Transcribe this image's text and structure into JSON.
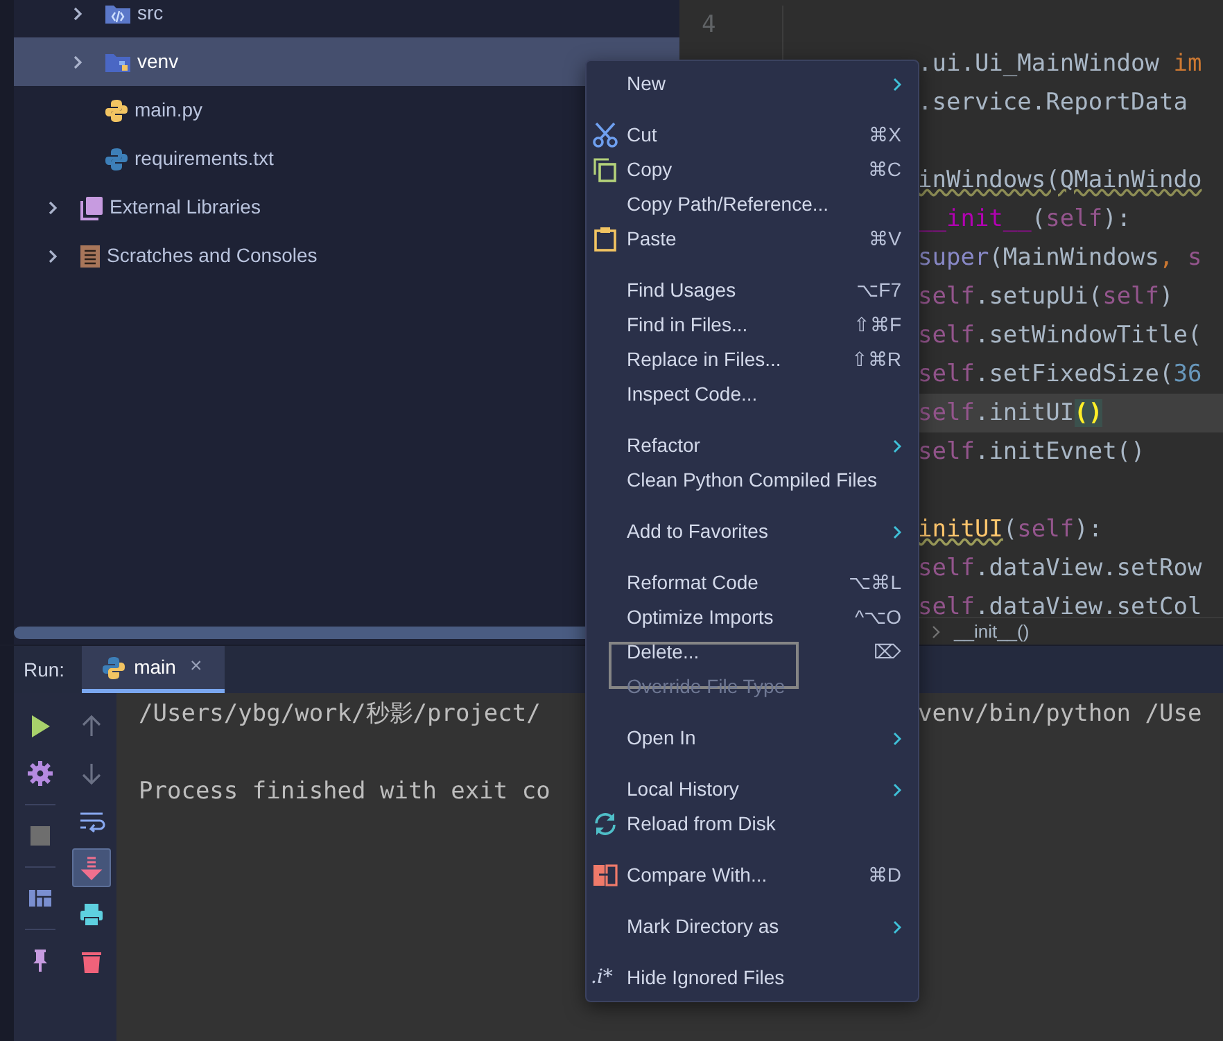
{
  "project_tree": {
    "root_children": [
      {
        "label": "src",
        "kind": "folder",
        "expanded": false,
        "selected": false
      },
      {
        "label": "venv",
        "kind": "folder",
        "expanded": false,
        "selected": true
      },
      {
        "label": "main.py",
        "kind": "file",
        "selected": false
      },
      {
        "label": "requirements.txt",
        "kind": "file",
        "selected": false
      }
    ],
    "items": [
      {
        "label": "External Libraries",
        "kind": "folder",
        "expanded": false,
        "selected": false
      },
      {
        "label": "Scratches and Consoles",
        "kind": "folder",
        "expanded": false,
        "selected": false
      }
    ]
  },
  "editor": {
    "line_number": "4",
    "lines": [
      {
        "kind": "code",
        "current": false,
        "segments": [
          {
            "kind": "plain",
            "text": ".ui.Ui_MainWindow "
          },
          {
            "kind": "keyword",
            "text": "im"
          }
        ]
      },
      {
        "kind": "code",
        "current": false,
        "segments": [
          {
            "kind": "plain",
            "text": ".service.ReportData"
          }
        ]
      },
      {
        "kind": "blank"
      },
      {
        "kind": "code",
        "current": false,
        "segments": [
          {
            "kind": "warn",
            "text": "inWindows(QMainWindo"
          }
        ]
      },
      {
        "kind": "code",
        "current": false,
        "segments": [
          {
            "kind": "magic",
            "text": "__init__"
          },
          {
            "kind": "plain",
            "text": "("
          },
          {
            "kind": "self",
            "text": "self"
          },
          {
            "kind": "plain",
            "text": "):"
          }
        ]
      },
      {
        "kind": "code",
        "current": false,
        "segments": [
          {
            "kind": "builtin",
            "text": "super"
          },
          {
            "kind": "plain",
            "text": "(MainWindows"
          },
          {
            "kind": "keyword",
            "text": ", "
          },
          {
            "kind": "self",
            "text": "s"
          }
        ]
      },
      {
        "kind": "code",
        "current": false,
        "segments": [
          {
            "kind": "self",
            "text": "self"
          },
          {
            "kind": "plain",
            "text": ".setupUi("
          },
          {
            "kind": "self",
            "text": "self"
          },
          {
            "kind": "plain",
            "text": ")"
          }
        ]
      },
      {
        "kind": "code",
        "current": false,
        "segments": [
          {
            "kind": "self",
            "text": "self"
          },
          {
            "kind": "plain",
            "text": ".setWindowTitle("
          }
        ]
      },
      {
        "kind": "code",
        "current": false,
        "segments": [
          {
            "kind": "self",
            "text": "self"
          },
          {
            "kind": "plain",
            "text": ".setFixedSize("
          },
          {
            "kind": "number",
            "text": "36"
          }
        ]
      },
      {
        "kind": "code",
        "current": true,
        "segments": [
          {
            "kind": "self",
            "text": "self"
          },
          {
            "kind": "plain",
            "text": ".initUI"
          },
          {
            "kind": "match",
            "text": "()"
          }
        ]
      },
      {
        "kind": "code",
        "current": false,
        "segments": [
          {
            "kind": "self",
            "text": "self"
          },
          {
            "kind": "plain",
            "text": ".initEvnet()"
          }
        ]
      },
      {
        "kind": "blank"
      },
      {
        "kind": "code",
        "current": false,
        "segments": [
          {
            "kind": "funcdef",
            "text": "initUI"
          },
          {
            "kind": "plain",
            "text": "("
          },
          {
            "kind": "self",
            "text": "self"
          },
          {
            "kind": "plain",
            "text": "):"
          }
        ]
      },
      {
        "kind": "code",
        "current": false,
        "segments": [
          {
            "kind": "self",
            "text": "self"
          },
          {
            "kind": "plain",
            "text": ".dataView.setRow"
          }
        ]
      },
      {
        "kind": "code",
        "current": false,
        "segments": [
          {
            "kind": "self",
            "text": "self"
          },
          {
            "kind": "plain",
            "text": ".dataView.setCol"
          }
        ]
      }
    ],
    "breadcrumb": "__init__()"
  },
  "run_panel": {
    "label": "Run:",
    "tabs": [
      {
        "label": "main",
        "selected": true,
        "close": "×"
      }
    ],
    "console_lines": [
      {
        "text": "/Users/ybg/work/秒影/project/",
        "continuation": "venv/bin/python /Use"
      },
      {
        "text": "Process finished with exit co"
      }
    ]
  },
  "context_menu": {
    "items": [
      {
        "kind": "item",
        "label": "New",
        "submenu": true,
        "disabled": false,
        "outlined": false
      },
      {
        "kind": "separator"
      },
      {
        "kind": "item",
        "label": "Cut",
        "shortcut": "⌘X",
        "submenu": false,
        "disabled": false,
        "outlined": false
      },
      {
        "kind": "item",
        "label": "Copy",
        "shortcut": "⌘C",
        "submenu": false,
        "disabled": false,
        "outlined": false
      },
      {
        "kind": "item",
        "label": "Copy Path/Reference...",
        "submenu": false,
        "disabled": false,
        "outlined": false
      },
      {
        "kind": "item",
        "label": "Paste",
        "shortcut": "⌘V",
        "submenu": false,
        "disabled": false,
        "outlined": false
      },
      {
        "kind": "separator"
      },
      {
        "kind": "item",
        "label": "Find Usages",
        "shortcut": "⌥F7",
        "submenu": false,
        "disabled": false,
        "outlined": false
      },
      {
        "kind": "item",
        "label": "Find in Files...",
        "shortcut": "⇧⌘F",
        "submenu": false,
        "disabled": false,
        "outlined": false
      },
      {
        "kind": "item",
        "label": "Replace in Files...",
        "shortcut": "⇧⌘R",
        "submenu": false,
        "disabled": false,
        "outlined": false
      },
      {
        "kind": "item",
        "label": "Inspect Code...",
        "submenu": false,
        "disabled": false,
        "outlined": false
      },
      {
        "kind": "separator"
      },
      {
        "kind": "item",
        "label": "Refactor",
        "submenu": true,
        "disabled": false,
        "outlined": false
      },
      {
        "kind": "item",
        "label": "Clean Python Compiled Files",
        "submenu": false,
        "disabled": false,
        "outlined": false
      },
      {
        "kind": "separator"
      },
      {
        "kind": "item",
        "label": "Add to Favorites",
        "submenu": true,
        "disabled": false,
        "outlined": false
      },
      {
        "kind": "separator"
      },
      {
        "kind": "item",
        "label": "Reformat Code",
        "shortcut": "⌥⌘L",
        "submenu": false,
        "disabled": false,
        "outlined": false
      },
      {
        "kind": "item",
        "label": "Optimize Imports",
        "shortcut": "^⌥O",
        "submenu": false,
        "disabled": false,
        "outlined": false
      },
      {
        "kind": "item",
        "label": "Delete...",
        "shortcut": "⌦",
        "submenu": false,
        "disabled": false,
        "outlined": true
      },
      {
        "kind": "item",
        "label": "Override File Type",
        "submenu": false,
        "disabled": true,
        "outlined": false
      },
      {
        "kind": "separator"
      },
      {
        "kind": "item",
        "label": "Open In",
        "submenu": true,
        "disabled": false,
        "outlined": false
      },
      {
        "kind": "separator"
      },
      {
        "kind": "item",
        "label": "Local History",
        "submenu": true,
        "disabled": false,
        "outlined": false
      },
      {
        "kind": "item",
        "label": "Reload from Disk",
        "submenu": false,
        "disabled": false,
        "outlined": false
      },
      {
        "kind": "separator"
      },
      {
        "kind": "item",
        "label": "Compare With...",
        "shortcut": "⌘D",
        "submenu": false,
        "disabled": false,
        "outlined": false
      },
      {
        "kind": "separator"
      },
      {
        "kind": "item",
        "label": "Mark Directory as",
        "submenu": true,
        "disabled": false,
        "outlined": false
      },
      {
        "kind": "separator"
      },
      {
        "kind": "item",
        "label": "Hide Ignored Files",
        "icon_text": ".i*",
        "submenu": false,
        "disabled": false,
        "outlined": false
      }
    ]
  }
}
